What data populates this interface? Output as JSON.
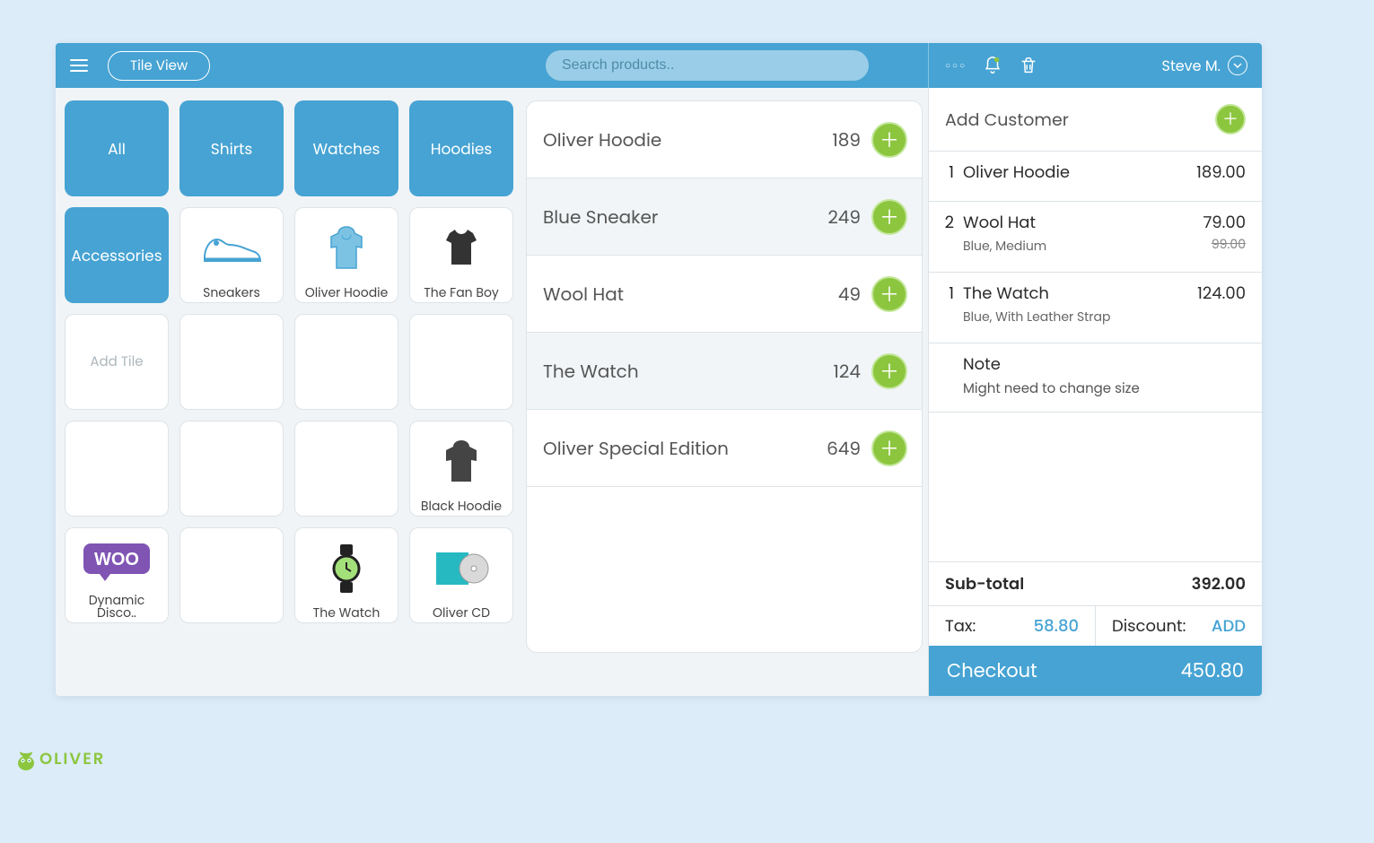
{
  "header": {
    "tile_view": "Tile View",
    "search_placeholder": "Search products..",
    "user_name": "Steve M."
  },
  "categories": [
    "All",
    "Shirts",
    "Watches",
    "Hoodies",
    "Accessories"
  ],
  "tiles": {
    "sneakers": "Sneakers",
    "oliver_hoodie": "Oliver Hoodie",
    "fan_boy": "The Fan Boy",
    "add_tile": "Add Tile",
    "black_hoodie": "Black Hoodie",
    "dynamic_disco": "Dynamic Disco..",
    "the_watch": "The Watch",
    "oliver_cd": "Oliver CD"
  },
  "products": [
    {
      "name": "Oliver Hoodie",
      "price": "189"
    },
    {
      "name": "Blue Sneaker",
      "price": "249"
    },
    {
      "name": "Wool Hat",
      "price": "49"
    },
    {
      "name": "The Watch",
      "price": "124"
    },
    {
      "name": "Oliver Special Edition",
      "price": "649"
    }
  ],
  "cart": {
    "add_customer": "Add Customer",
    "items": [
      {
        "qty": "1",
        "name": "Oliver Hoodie",
        "variant": "",
        "price": "189.00",
        "original": ""
      },
      {
        "qty": "2",
        "name": "Wool Hat",
        "variant": "Blue, Medium",
        "price": "79.00",
        "original": "99.00"
      },
      {
        "qty": "1",
        "name": "The Watch",
        "variant": "Blue, With Leather Strap",
        "price": "124.00",
        "original": ""
      }
    ],
    "note_title": "Note",
    "note_text": "Might need to change size",
    "subtotal_label": "Sub-total",
    "subtotal": "392.00",
    "tax_label": "Tax:",
    "tax": "58.80",
    "discount_label": "Discount:",
    "discount_action": "ADD",
    "checkout_label": "Checkout",
    "checkout_total": "450.80"
  },
  "brand": "OLIVER"
}
